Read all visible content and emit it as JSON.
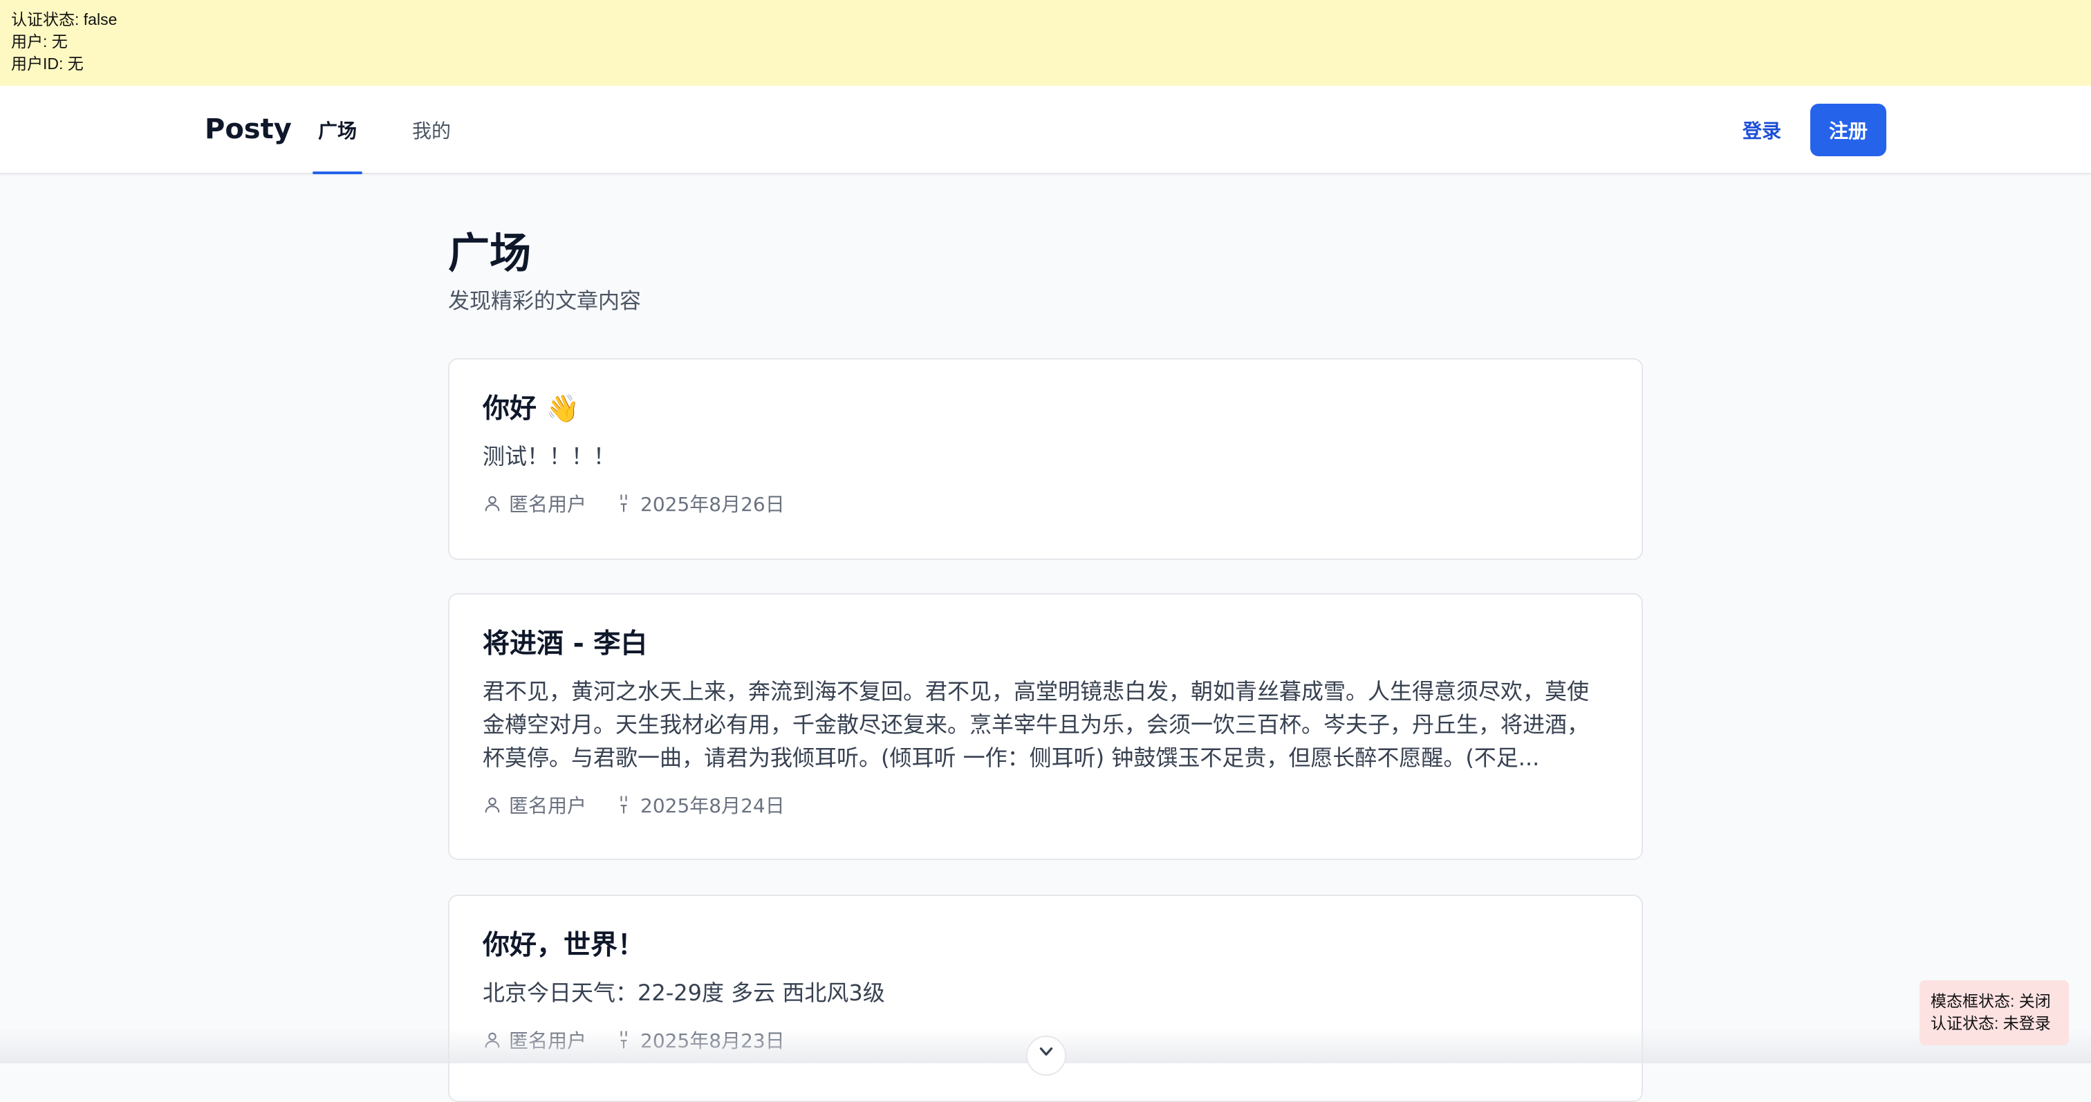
{
  "debug": {
    "auth_status": "认证状态: false",
    "user": "用户: 无",
    "user_id": "用户ID: 无"
  },
  "navbar": {
    "brand": "Posty",
    "tabs": [
      {
        "label": "广场",
        "active": true
      },
      {
        "label": "我的",
        "active": false
      }
    ],
    "login_label": "登录",
    "signup_label": "注册"
  },
  "page": {
    "title": "广场",
    "subtitle": "发现精彩的文章内容"
  },
  "posts": [
    {
      "title": "你好 👋",
      "body": "测试！！！！",
      "author": "匿名用户",
      "date": "2025年8月26日"
    },
    {
      "title": "将进酒 - 李白",
      "body": "君不见，黄河之水天上来，奔流到海不复回。君不见，高堂明镜悲白发，朝如青丝暮成雪。人生得意须尽欢，莫使金樽空对月。天生我材必有用，千金散尽还复来。烹羊宰牛且为乐，会须一饮三百杯。岑夫子，丹丘生，将进酒，杯莫停。与君歌一曲，请君为我倾耳听。(倾耳听 一作：侧耳听) 钟鼓馔玉不足贵，但愿长醉不愿醒。(不足...",
      "author": "匿名用户",
      "date": "2025年8月24日"
    },
    {
      "title": "你好，世界！",
      "body": "北京今日天气：22-29度 多云 西北风3级",
      "author": "匿名用户",
      "date": "2025年8月23日"
    }
  ],
  "status_panel": {
    "modal_status": "模态框状态: 关闭",
    "auth_status": "认证状态: 未登录"
  },
  "colors": {
    "accent": "#2563eb",
    "banner_bg": "#fef9c3",
    "status_panel_bg": "#fde2e2",
    "page_bg": "#f8fafc"
  },
  "icons": {
    "author": "user-icon",
    "date": "calendar-icon",
    "scroll": "chevron-down-icon"
  }
}
